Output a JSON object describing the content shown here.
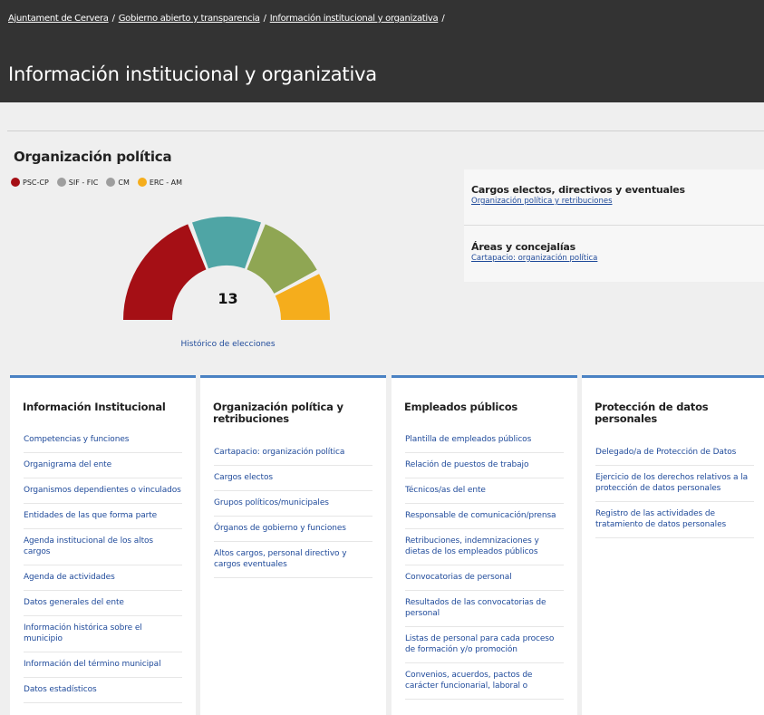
{
  "breadcrumb": {
    "items": [
      "Ajuntament de Cervera",
      "Gobierno abierto y transparencia",
      "Información institucional y organizativa"
    ],
    "separator": "/"
  },
  "page_title": "Información institucional y organizativa",
  "political": {
    "title": "Organización política",
    "legend": [
      {
        "label": "PSC-CP",
        "color": "#a50f15"
      },
      {
        "label": "SIF - FIC",
        "color": "#9e9e9e"
      },
      {
        "label": "CM",
        "color": "#9e9e9e"
      },
      {
        "label": "ERC - AM",
        "color": "#f5ad1c"
      }
    ],
    "gauge": {
      "total": "13",
      "segments": [
        {
          "value": 5,
          "color": "#a50f15"
        },
        {
          "value": 3,
          "color": "#4fa5a5"
        },
        {
          "value": 3,
          "color": "#8fa653"
        },
        {
          "value": 2,
          "color": "#f5ad1c"
        }
      ]
    },
    "history_link": "Histórico de elecciones"
  },
  "side_panel": [
    {
      "title": "Cargos electos, directivos y eventuales",
      "link": "Organización política y retribuciones"
    },
    {
      "title": "Áreas y concejalías",
      "link": "Cartapacio: organización política"
    }
  ],
  "cards": [
    {
      "title": "Información Institucional",
      "items": [
        "Competencias y funciones",
        "Organigrama del ente",
        "Organismos dependientes o vinculados",
        "Entidades de las que forma parte",
        "Agenda institucional de los altos cargos",
        "Agenda de actividades",
        "Datos generales del ente",
        "Información histórica sobre el municipio",
        "Información del término municipal",
        "Datos estadísticos"
      ]
    },
    {
      "title": "Organización política y retribuciones",
      "items": [
        "Cartapacio: organización política",
        "Cargos electos",
        "Grupos políticos/municipales",
        "Órganos de gobierno y funciones",
        "Altos cargos, personal directivo y cargos eventuales"
      ]
    },
    {
      "title": "Empleados públicos",
      "items": [
        "Plantilla de empleados públicos",
        "Relación de puestos de trabajo",
        "Técnicos/as del ente",
        "Responsable de comunicación/prensa",
        "Retribuciones, indemnizaciones y dietas de los empleados públicos",
        "Convocatorias de personal",
        "Resultados de las convocatorias de personal",
        "Listas de personal para cada proceso de formación y/o promoción",
        "Convenios, acuerdos, pactos de carácter funcionarial, laboral o"
      ]
    },
    {
      "title": "Protección de datos personales",
      "items": [
        "Delegado/a de Protección de Datos",
        "Ejercicio de los derechos relativos a la protección de datos personales",
        "Registro de las actividades de tratamiento de datos personales"
      ]
    }
  ]
}
